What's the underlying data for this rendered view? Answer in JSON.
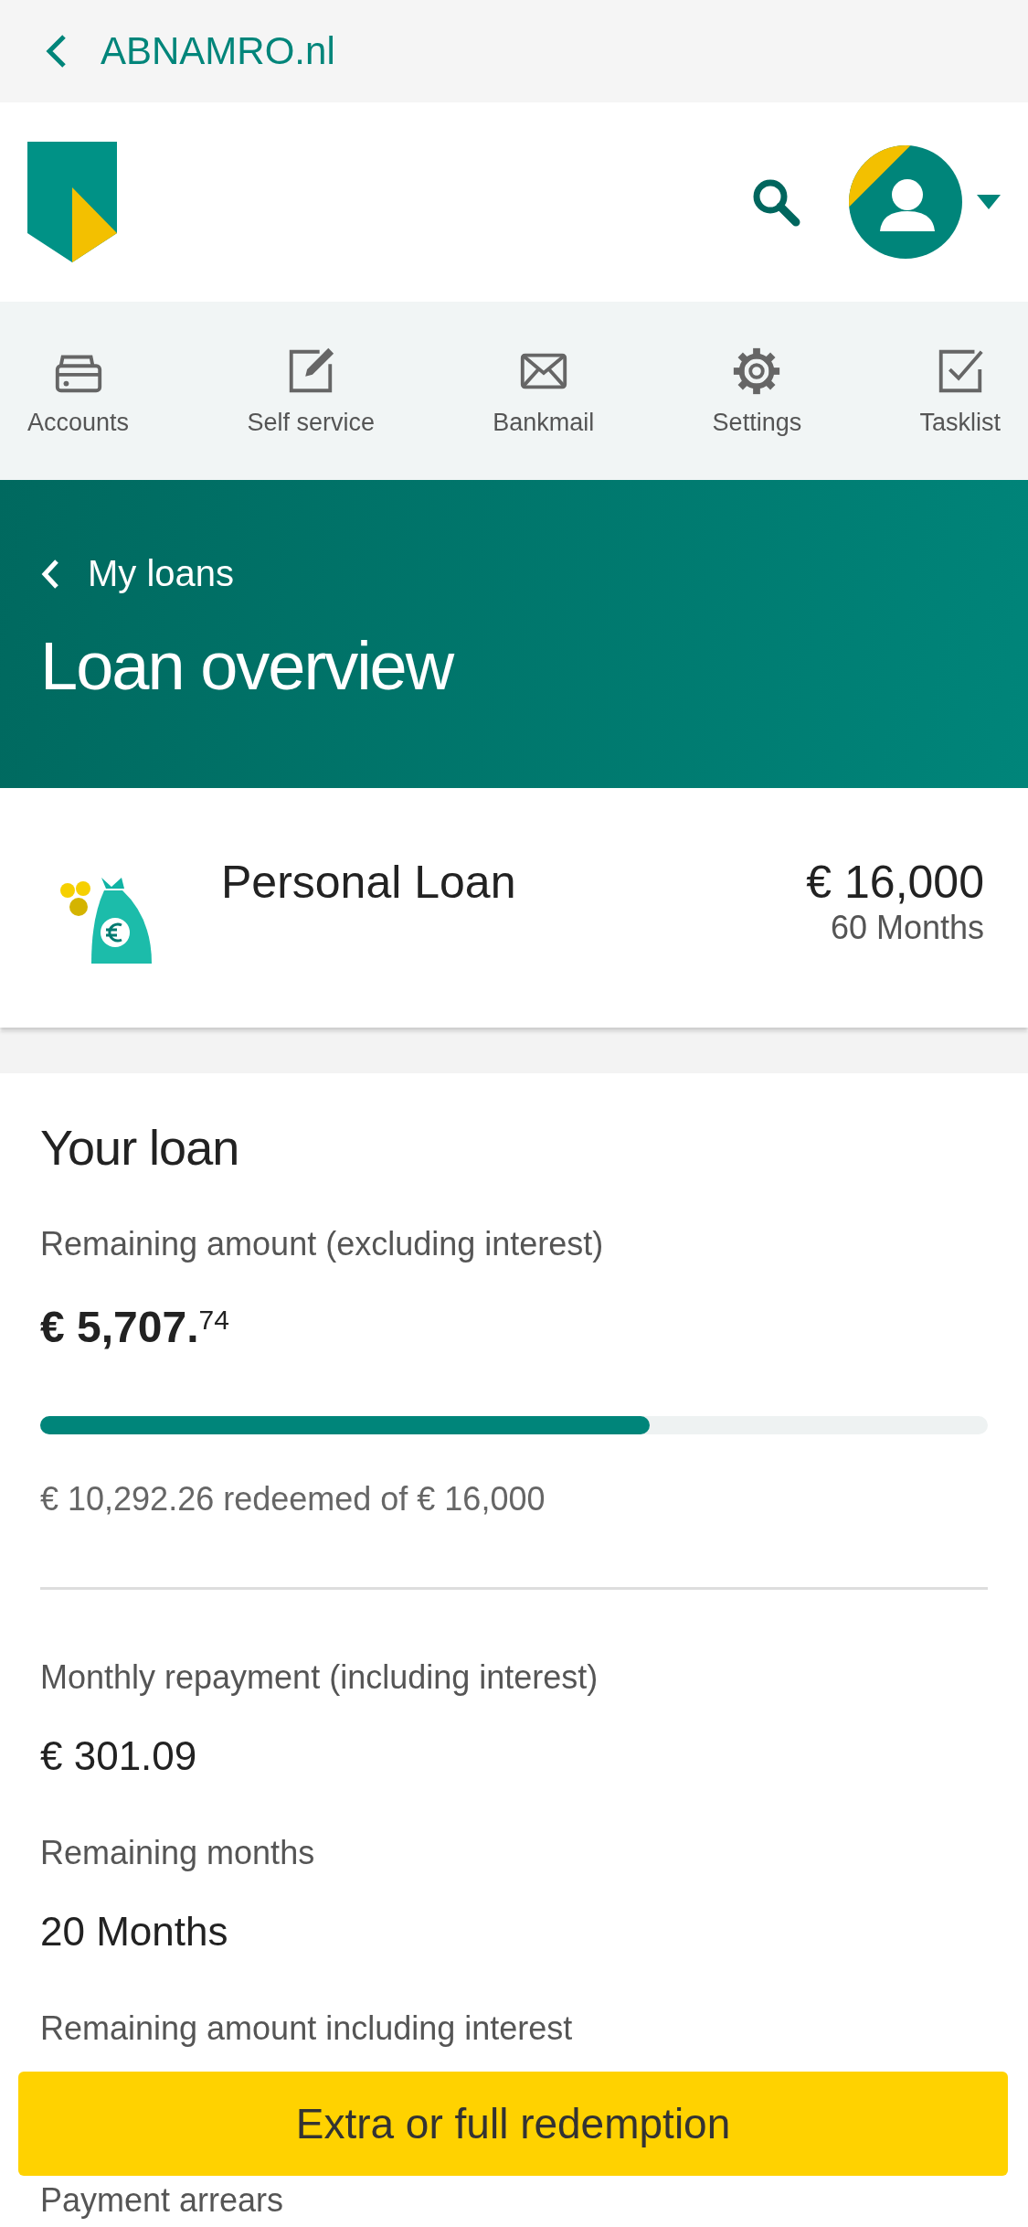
{
  "browser_bar": {
    "back": "ABNAMRO.nl"
  },
  "nav": [
    {
      "label": "Accounts",
      "kind": "wallet"
    },
    {
      "label": "Self service",
      "kind": "edit"
    },
    {
      "label": "Bankmail",
      "kind": "mail"
    },
    {
      "label": "Settings",
      "kind": "gear"
    },
    {
      "label": "Tasklist",
      "kind": "check"
    }
  ],
  "banner": {
    "back": "My loans",
    "title": "Loan overview"
  },
  "loan": {
    "name": "Personal Loan",
    "amount": "€ 16,000",
    "term": "60 Months"
  },
  "details": {
    "title": "Your loan",
    "remaining_label": "Remaining amount (excluding interest)",
    "remaining_value": "€ 5,707.$^{74}$",
    "level": 0.643,
    "redeemed": "€ 10,292.26 redeemed of € 16,000",
    "fields": [
      {
        "label": "Monthly repayment (including interest)",
        "value": "€ 301.09"
      },
      {
        "label": "Remaining months",
        "value": "20 Months"
      },
      {
        "label": "Remaining amount including interest"
      },
      {
        "label": "Payment arrears"
      }
    ]
  },
  "action_button": "Extra or full redemption"
}
